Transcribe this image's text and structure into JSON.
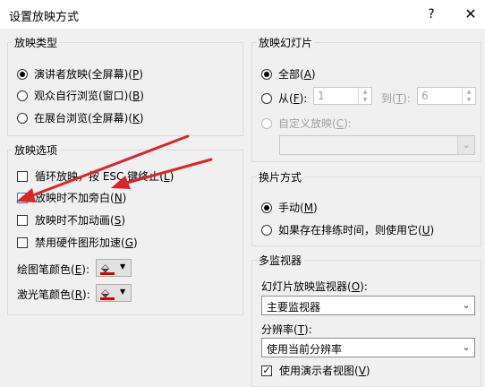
{
  "window": {
    "title": "设置放映方式",
    "help_icon": "?",
    "close_icon": "✕"
  },
  "show_type": {
    "label": "放映类型",
    "options": [
      {
        "text": "演讲者放映(全屏幕)(",
        "key": "P",
        "end": ")",
        "selected": true
      },
      {
        "text": "观众自行浏览(窗口)(",
        "key": "B",
        "end": ")",
        "selected": false
      },
      {
        "text": "在展台浏览(全屏幕)(",
        "key": "K",
        "end": ")",
        "selected": false
      }
    ]
  },
  "show_options": {
    "label": "放映选项",
    "checks": [
      {
        "text": "循环放映，按 ESC 键终止(",
        "key": "L",
        "end": ")",
        "checked": false
      },
      {
        "text": "放映时不加旁白(",
        "key": "N",
        "end": ")",
        "checked": false
      },
      {
        "text": "放映时不加动画(",
        "key": "S",
        "end": ")",
        "checked": false
      },
      {
        "text": "禁用硬件图形加速(",
        "key": "G",
        "end": ")",
        "checked": false
      }
    ],
    "pen_color": {
      "label": "绘图笔颜色(",
      "key": "E",
      "end": "):",
      "color": "#e00000"
    },
    "laser_color": {
      "label": "激光笔颜色(",
      "key": "R",
      "end": "):",
      "color": "#e00000"
    }
  },
  "slides": {
    "label": "放映幻灯片",
    "all": {
      "text": "全部(",
      "key": "A",
      "end": ")",
      "selected": true
    },
    "from": {
      "text": "从(",
      "key": "F",
      "end": "):",
      "selected": false,
      "value": "1"
    },
    "to": {
      "text": "到(",
      "key": "T",
      "end": "):",
      "value": "6"
    },
    "custom": {
      "text": "自定义放映(",
      "key": "C",
      "end": "):",
      "enabled": false,
      "value": ""
    }
  },
  "advance": {
    "label": "换片方式",
    "options": [
      {
        "text": "手动(",
        "key": "M",
        "end": ")",
        "selected": true
      },
      {
        "text": "如果存在排练时间，则使用它(",
        "key": "U",
        "end": ")",
        "selected": false
      }
    ]
  },
  "monitors": {
    "label": "多监视器",
    "monitor_label": {
      "text": "幻灯片放映监视器(",
      "key": "O",
      "end": "):"
    },
    "monitor_value": "主要监视器",
    "resolution_label": {
      "text": "分辨率(",
      "key": "T",
      "end": "):"
    },
    "resolution_value": "使用当前分辨率",
    "presenter_view": {
      "text": "使用演示者视图(",
      "key": "V",
      "end": ")",
      "checked": true
    }
  },
  "annotations": {
    "arrow_color": "#d9262a"
  }
}
